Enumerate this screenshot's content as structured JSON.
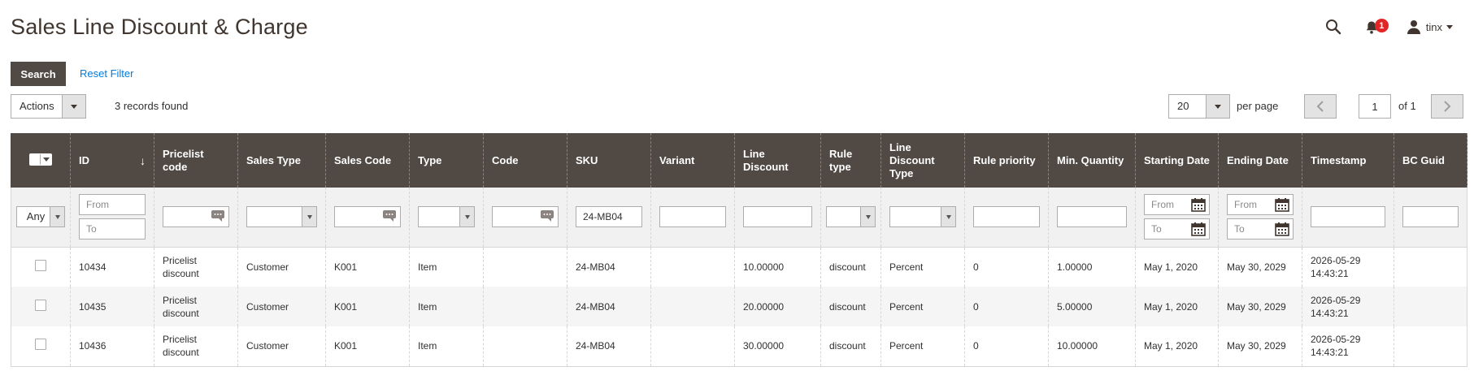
{
  "page": {
    "title": "Sales Line Discount & Charge"
  },
  "header": {
    "notification_count": "1",
    "user_name": "tinx"
  },
  "toolbar": {
    "search_label": "Search",
    "reset_label": "Reset Filter",
    "actions_label": "Actions",
    "records_found": "3 records found",
    "per_page_value": "20",
    "per_page_label": "per page",
    "current_page": "1",
    "of_pages": "of 1"
  },
  "columns": [
    "ID",
    "Pricelist code",
    "Sales Type",
    "Sales Code",
    "Type",
    "Code",
    "SKU",
    "Variant",
    "Line Discount",
    "Rule type",
    "Line Discount Type",
    "Rule priority",
    "Min. Quantity",
    "Starting Date",
    "Ending Date",
    "Timestamp",
    "BC Guid"
  ],
  "filters": {
    "any_label": "Any",
    "from_placeholder": "From",
    "to_placeholder": "To",
    "sku_value": "24-MB04"
  },
  "rows": [
    {
      "id": "10434",
      "pricelist_code": "Pricelist discount",
      "sales_type": "Customer",
      "sales_code": "K001",
      "type": "Item",
      "code": "",
      "sku": "24-MB04",
      "variant": "",
      "line_discount": "10.00000",
      "rule_type": "discount",
      "line_discount_type": "Percent",
      "rule_priority": "0",
      "min_quantity": "1.00000",
      "starting_date": "May 1, 2020",
      "ending_date": "May 30, 2029",
      "timestamp": "2026-05-29 14:43:21",
      "bc_guid": ""
    },
    {
      "id": "10435",
      "pricelist_code": "Pricelist discount",
      "sales_type": "Customer",
      "sales_code": "K001",
      "type": "Item",
      "code": "",
      "sku": "24-MB04",
      "variant": "",
      "line_discount": "20.00000",
      "rule_type": "discount",
      "line_discount_type": "Percent",
      "rule_priority": "0",
      "min_quantity": "5.00000",
      "starting_date": "May 1, 2020",
      "ending_date": "May 30, 2029",
      "timestamp": "2026-05-29 14:43:21",
      "bc_guid": ""
    },
    {
      "id": "10436",
      "pricelist_code": "Pricelist discount",
      "sales_type": "Customer",
      "sales_code": "K001",
      "type": "Item",
      "code": "",
      "sku": "24-MB04",
      "variant": "",
      "line_discount": "30.00000",
      "rule_type": "discount",
      "line_discount_type": "Percent",
      "rule_priority": "0",
      "min_quantity": "10.00000",
      "starting_date": "May 1, 2020",
      "ending_date": "May 30, 2029",
      "timestamp": "2026-05-29 14:43:21",
      "bc_guid": ""
    }
  ],
  "icons": {
    "search": "search-icon",
    "notifications": "bell-icon",
    "user": "user-icon",
    "calendar": "calendar-icon",
    "chat": "speech-bubble-icon",
    "sort": "sort-desc-icon"
  },
  "colors": {
    "header_bg": "#514943",
    "link": "#007bdb",
    "badge": "#e22626"
  }
}
